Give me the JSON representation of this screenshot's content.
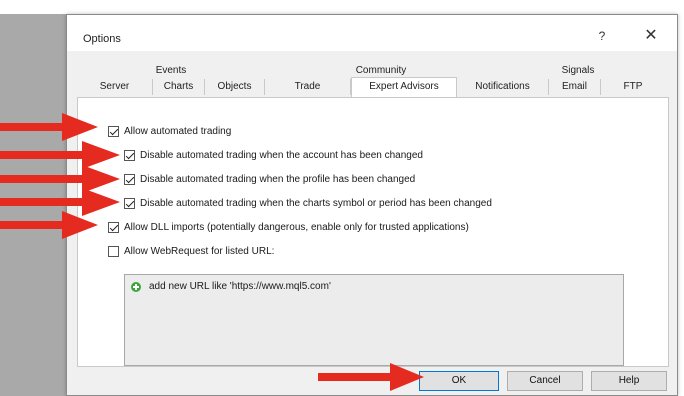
{
  "window": {
    "title": "Options",
    "help_label": "?",
    "close_label": "✕"
  },
  "tabs": {
    "row1": [
      "Events",
      "Community",
      "Signals"
    ],
    "row2": [
      "Server",
      "Charts",
      "Objects",
      "Trade",
      "Expert Advisors",
      "Notifications",
      "Email",
      "FTP"
    ],
    "active": "Expert Advisors"
  },
  "options": [
    {
      "label": "Allow automated trading",
      "checked": true
    },
    {
      "label": "Disable automated trading when the account has been changed",
      "checked": true
    },
    {
      "label": "Disable automated trading when the profile has been changed",
      "checked": true
    },
    {
      "label": "Disable automated trading when the charts symbol or period has been changed",
      "checked": true
    },
    {
      "label": "Allow DLL imports (potentially dangerous, enable only for trusted applications)",
      "checked": true
    },
    {
      "label": "Allow WebRequest for listed URL:",
      "checked": false
    }
  ],
  "url_list": {
    "add_item": "add new URL like 'https://www.mql5.com'",
    "icon": "add-green-icon"
  },
  "buttons": {
    "ok": "OK",
    "cancel": "Cancel",
    "help": "Help"
  },
  "colors": {
    "arrow": "#e52a1f",
    "default_button_border": "#0078d7",
    "plus_icon": "#3aa63a"
  }
}
